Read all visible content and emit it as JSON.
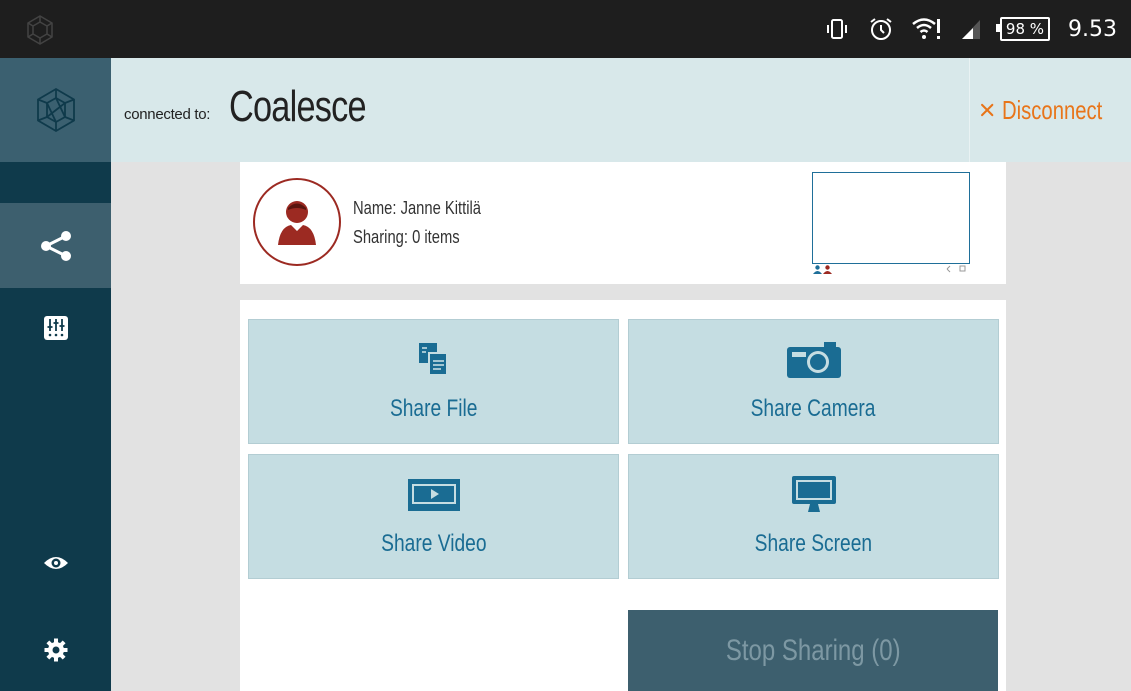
{
  "status_bar": {
    "battery": "98 %",
    "time": "9.53",
    "icons": [
      "vibrate-icon",
      "alarm-icon",
      "wifi-alert-icon",
      "signal-icon",
      "battery-icon"
    ]
  },
  "header": {
    "connected_label": "connected to:",
    "connected_name": "Coalesce",
    "disconnect_label": "Disconnect"
  },
  "sidebar": {
    "items": [
      {
        "icon": "share-icon",
        "active": true
      },
      {
        "icon": "mixer-icon",
        "active": false
      },
      {
        "icon": "eye-icon",
        "active": false
      },
      {
        "icon": "gear-icon",
        "active": false
      }
    ]
  },
  "profile": {
    "name": "Name: Janne Kittilä",
    "sharing": "Sharing: 0 items"
  },
  "actions": {
    "share_file": "Share File",
    "share_camera": "Share Camera",
    "share_video": "Share Video",
    "share_screen": "Share Screen",
    "stop_sharing": "Stop Sharing (0)"
  },
  "colors": {
    "sidebar": "#0f3a4b",
    "header": "#d8e8ea",
    "tile": "#c5dde2",
    "accent_blue": "#1a6c93",
    "disconnect": "#e8751a",
    "avatar": "#9c2a22"
  }
}
